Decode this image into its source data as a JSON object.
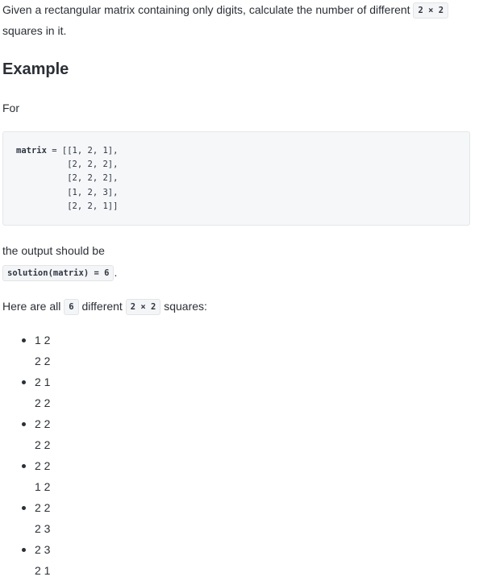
{
  "intro": {
    "text_before": "Given a rectangular matrix containing only digits, calculate the number of different ",
    "size_code": "2 × 2",
    "text_after": "squares in it."
  },
  "example": {
    "heading": "Example",
    "for_label": "For",
    "code_lines": [
      "matrix = [[1, 2, 1],",
      "          [2, 2, 2],",
      "          [2, 2, 2],",
      "          [1, 2, 3],",
      "          [2, 2, 1]]"
    ],
    "output_label": "the output should be",
    "output_code": "solution(matrix) = 6",
    "output_period": "."
  },
  "summary": {
    "text_before": "Here are all ",
    "count_code": "6",
    "text_middle": " different ",
    "size_code": "2 × 2",
    "text_after": " squares:"
  },
  "squares": [
    {
      "row1": "1 2",
      "row2": "2 2"
    },
    {
      "row1": "2 1",
      "row2": "2 2"
    },
    {
      "row1": "2 2",
      "row2": "2 2"
    },
    {
      "row1": "2 2",
      "row2": "1 2"
    },
    {
      "row1": "2 2",
      "row2": "2 3"
    },
    {
      "row1": "2 3",
      "row2": "2 1"
    }
  ]
}
